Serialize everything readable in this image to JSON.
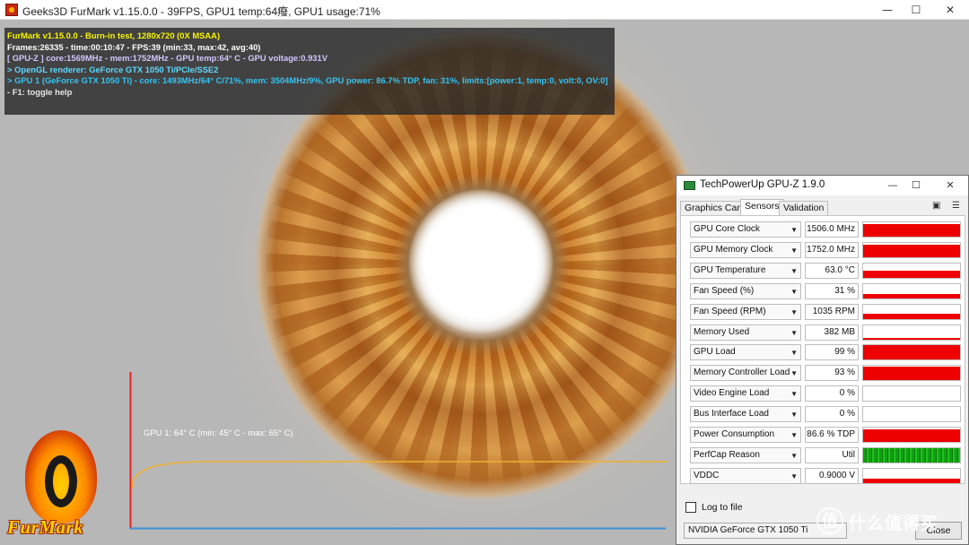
{
  "furmark": {
    "window_title": "Geeks3D FurMark v1.15.0.0 - 39FPS, GPU1 temp:64癈, GPU1 usage:71%",
    "minimize_glyph": "—",
    "maximize_glyph": "☐",
    "close_glyph": "✕",
    "overlay_lines": [
      "FurMark v1.15.0.0 - Burn-in test, 1280x720 (0X MSAA)",
      "Frames:26335 - time:00:10:47 - FPS:39 (min:33, max:42, avg:40)",
      "[ GPU-Z ] core:1569MHz - mem:1752MHz - GPU temp:64° C - GPU voltage:0.931V",
      "> OpenGL renderer: GeForce GTX 1050 Ti/PCIe/SSE2",
      "> GPU 1 (GeForce GTX 1050 Ti) - core: 1493MHz/64° C/71%, mem: 3504MHz/9%, GPU power: 86.7% TDP, fan: 31%, limits:[power:1, temp:0, volt:0, OV:0]",
      "- F1: toggle help"
    ],
    "logo_text": "FurMark",
    "graph_label": "GPU 1: 64° C (min: 45° C - max: 65° C)",
    "graph_colors": {
      "axis_red": "#e82020",
      "axis_blue": "#3b8fd6",
      "line": "#f0b030"
    }
  },
  "gpuz": {
    "window_title": "TechPowerUp GPU-Z 1.9.0",
    "minimize_glyph": "—",
    "maximize_glyph": "☐",
    "close_glyph": "✕",
    "tabs": [
      "Graphics Card",
      "Sensors",
      "Validation"
    ],
    "active_tab": "Sensors",
    "camera_icon": "▣",
    "menu_icon": "☰",
    "dropdown_glyph": "▼",
    "sensors": [
      {
        "name": "GPU Core Clock",
        "value": "1506.0 MHz",
        "level": 0.88
      },
      {
        "name": "GPU Memory Clock",
        "value": "1752.0 MHz",
        "level": 0.85
      },
      {
        "name": "GPU Temperature",
        "value": "63.0 °C",
        "level": 0.5
      },
      {
        "name": "Fan Speed (%)",
        "value": "31 %",
        "level": 0.3
      },
      {
        "name": "Fan Speed (RPM)",
        "value": "1035 RPM",
        "level": 0.35
      },
      {
        "name": "Memory Used",
        "value": "382 MB",
        "level": 0.12
      },
      {
        "name": "GPU Load",
        "value": "99 %",
        "level": 0.99
      },
      {
        "name": "Memory Controller Load",
        "value": "93 %",
        "level": 0.93
      },
      {
        "name": "Video Engine Load",
        "value": "0 %",
        "level": 0
      },
      {
        "name": "Bus Interface Load",
        "value": "0 %",
        "level": 0
      },
      {
        "name": "Power Consumption",
        "value": "86.6 % TDP",
        "level": 0.87
      },
      {
        "name": "PerfCap Reason",
        "value": "Util",
        "level": 1,
        "pattern": "green-stripes"
      },
      {
        "name": "VDDC",
        "value": "0.9000 V",
        "level": 0.3
      }
    ],
    "log_to_file": "Log to file",
    "log_checked": false,
    "gpu_select": "NVIDIA GeForce GTX 1050 Ti",
    "close_label": "Close",
    "graph_color": "#ee0000"
  },
  "watermark": {
    "badge": "值",
    "text": "什么值得买"
  }
}
